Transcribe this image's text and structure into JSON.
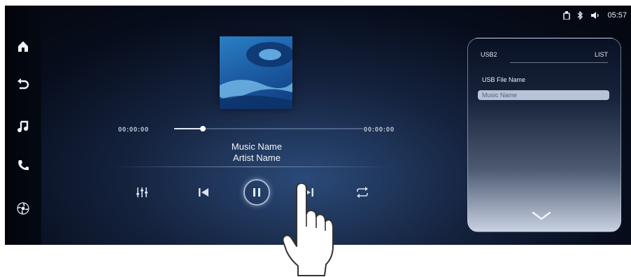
{
  "status_bar": {
    "icons": [
      "usb-icon",
      "bluetooth-icon",
      "volume-icon"
    ],
    "clock": "05:57"
  },
  "sidebar": {
    "items": [
      {
        "name": "home",
        "icon": "home-icon"
      },
      {
        "name": "back",
        "icon": "back-icon"
      },
      {
        "name": "music",
        "icon": "music-note-icon"
      },
      {
        "name": "phone",
        "icon": "phone-icon"
      },
      {
        "name": "climate",
        "icon": "fan-icon"
      }
    ]
  },
  "player": {
    "elapsed": "00:00:00",
    "total": "00:00:00",
    "progress_fraction": 0.15,
    "song_title": "Music Name",
    "artist": "Artist Name",
    "controls": [
      "equalizer-icon",
      "previous-icon",
      "pause-icon",
      "next-icon",
      "repeat-icon"
    ]
  },
  "file_panel": {
    "source": "USB2",
    "view": "LIST",
    "files": [
      {
        "label": "USB File Name",
        "selected": false
      },
      {
        "label": "Music Name",
        "selected": true
      }
    ]
  },
  "colors": {
    "screen_bg": "#070d1c",
    "accent": "#dfe8f7",
    "selected_item": "#b8c3d8"
  }
}
